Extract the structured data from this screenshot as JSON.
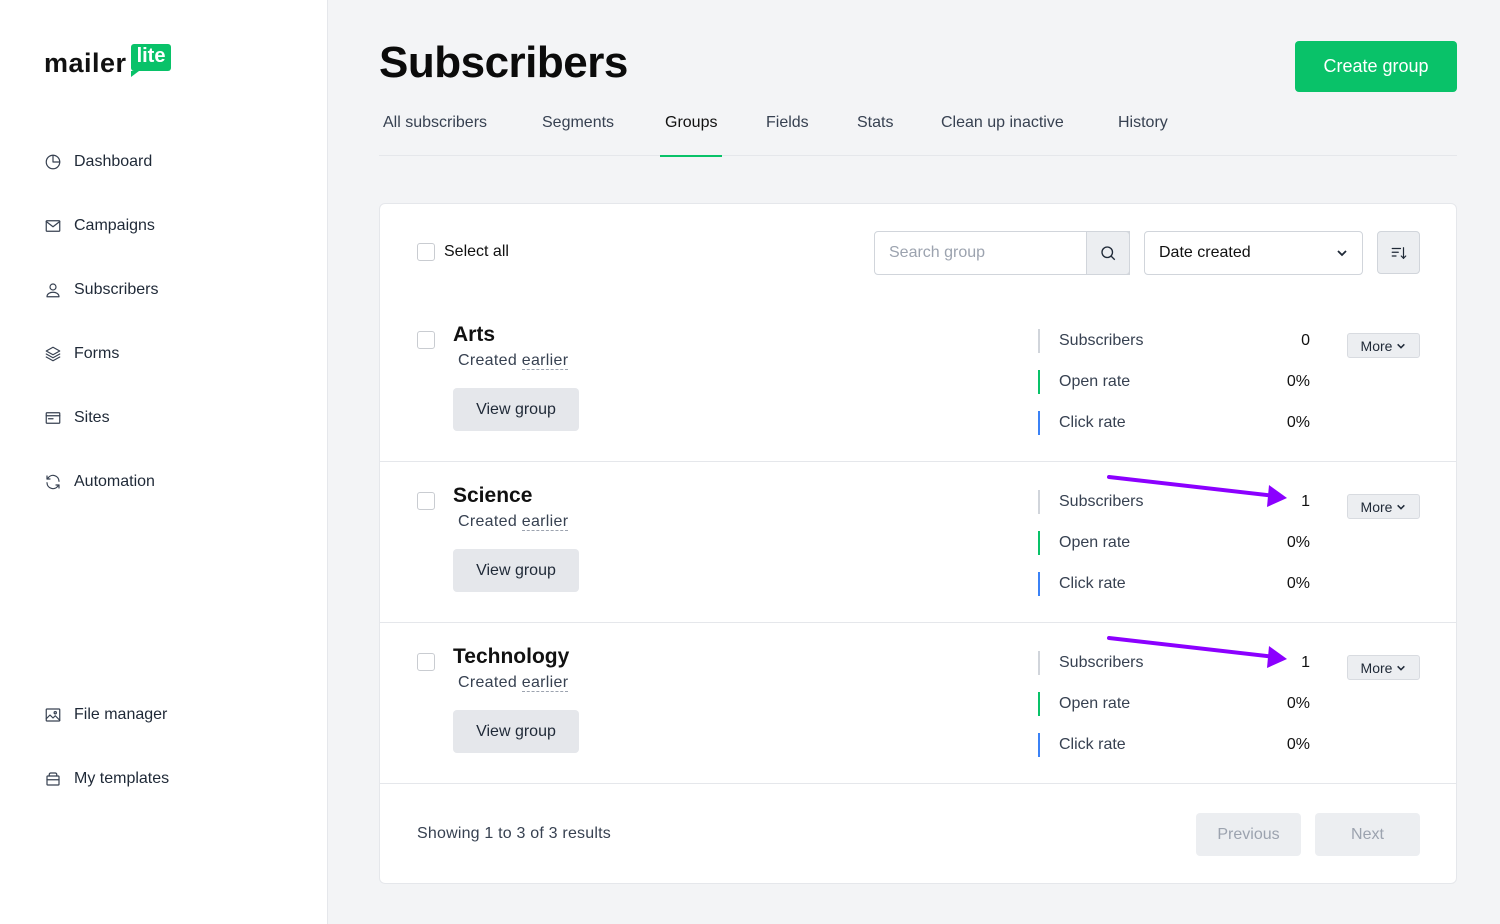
{
  "brand": {
    "word": "mailer",
    "badge": "lite",
    "accent": "#09c269"
  },
  "sidebar": {
    "items": [
      {
        "label": "Dashboard",
        "icon": "dashboard-icon"
      },
      {
        "label": "Campaigns",
        "icon": "mail-icon"
      },
      {
        "label": "Subscribers",
        "icon": "user-icon"
      },
      {
        "label": "Forms",
        "icon": "layers-icon"
      },
      {
        "label": "Sites",
        "icon": "browser-icon"
      },
      {
        "label": "Automation",
        "icon": "refresh-icon"
      }
    ],
    "bottom_items": [
      {
        "label": "File manager",
        "icon": "image-icon"
      },
      {
        "label": "My templates",
        "icon": "template-icon"
      }
    ]
  },
  "header": {
    "title": "Subscribers",
    "create_label": "Create group"
  },
  "tabs": [
    {
      "label": "All subscribers",
      "active": false
    },
    {
      "label": "Segments",
      "active": false
    },
    {
      "label": "Groups",
      "active": true
    },
    {
      "label": "Fields",
      "active": false
    },
    {
      "label": "Stats",
      "active": false
    },
    {
      "label": "Clean up inactive",
      "active": false
    },
    {
      "label": "History",
      "active": false
    }
  ],
  "toolbar": {
    "select_all_label": "Select all",
    "search_placeholder": "Search group",
    "sort_value": "Date created"
  },
  "groups": [
    {
      "name": "Arts",
      "created_prefix": "Created",
      "created_when": "earlier",
      "view_label": "View group",
      "stats": {
        "subscribers_label": "Subscribers",
        "subscribers": "0",
        "open_label": "Open rate",
        "open_rate": "0%",
        "click_label": "Click rate",
        "click_rate": "0%"
      },
      "more_label": "More"
    },
    {
      "name": "Science",
      "created_prefix": "Created",
      "created_when": "earlier",
      "view_label": "View group",
      "stats": {
        "subscribers_label": "Subscribers",
        "subscribers": "1",
        "open_label": "Open rate",
        "open_rate": "0%",
        "click_label": "Click rate",
        "click_rate": "0%"
      },
      "more_label": "More"
    },
    {
      "name": "Technology",
      "created_prefix": "Created",
      "created_when": "earlier",
      "view_label": "View group",
      "stats": {
        "subscribers_label": "Subscribers",
        "subscribers": "1",
        "open_label": "Open rate",
        "open_rate": "0%",
        "click_label": "Click rate",
        "click_rate": "0%"
      },
      "more_label": "More"
    }
  ],
  "colors": {
    "subscribers_bar": "#d1d5db",
    "open_bar": "#09c269",
    "click_bar": "#3b82f6",
    "annotation_arrow": "#8b00ff"
  },
  "pagination": {
    "summary": "Showing 1 to 3 of 3 results",
    "previous_label": "Previous",
    "next_label": "Next"
  }
}
